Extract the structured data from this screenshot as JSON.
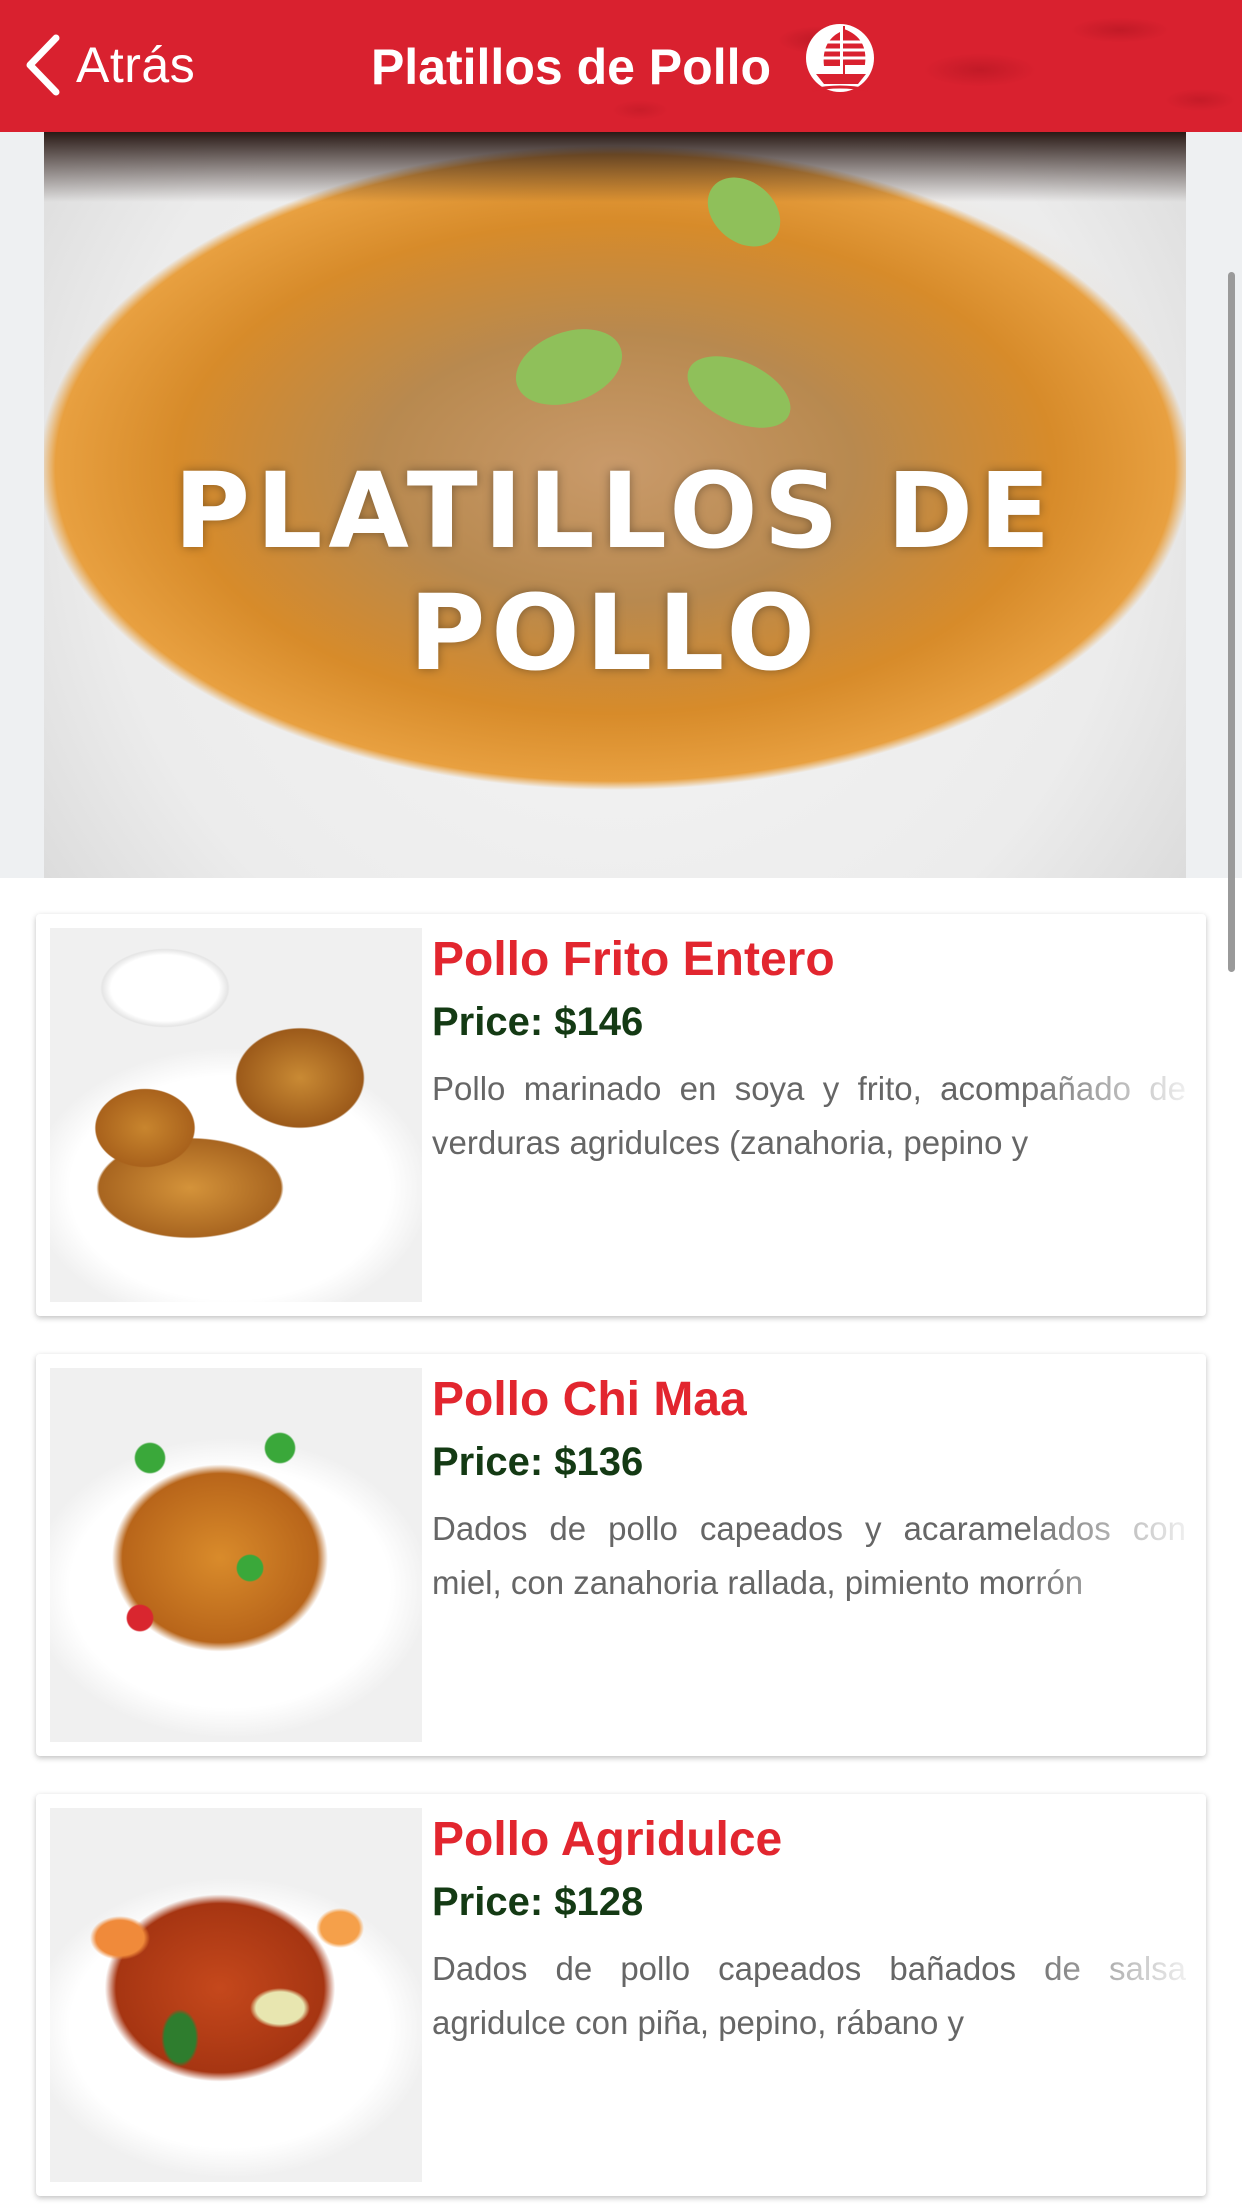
{
  "navbar": {
    "back_label": "Atrás",
    "title": "Platillos de Pollo",
    "logo_icon": "junk-boat-logo-icon",
    "color": "#d9212f"
  },
  "hero": {
    "overlay_text": "PLATILLOS DE POLLO"
  },
  "items": [
    {
      "name": "Pollo Frito Entero",
      "price": "Price: $146",
      "description": "Pollo marinado en soya y frito, acompañado de verduras agridulces (zanahoria, pepino y"
    },
    {
      "name": "Pollo Chi Maa",
      "price": "Price: $136",
      "description": "Dados de pollo capeados y acaramelados con miel, con zanahoria rallada, pimiento morrón"
    },
    {
      "name": "Pollo Agridulce",
      "price": "Price: $128",
      "description": "Dados de pollo capeados bañados de salsa agridulce con piña, pepino, rábano y"
    }
  ],
  "colors": {
    "accent_red": "#e2262f",
    "price_green": "#143a14",
    "description_gray": "#666666"
  }
}
